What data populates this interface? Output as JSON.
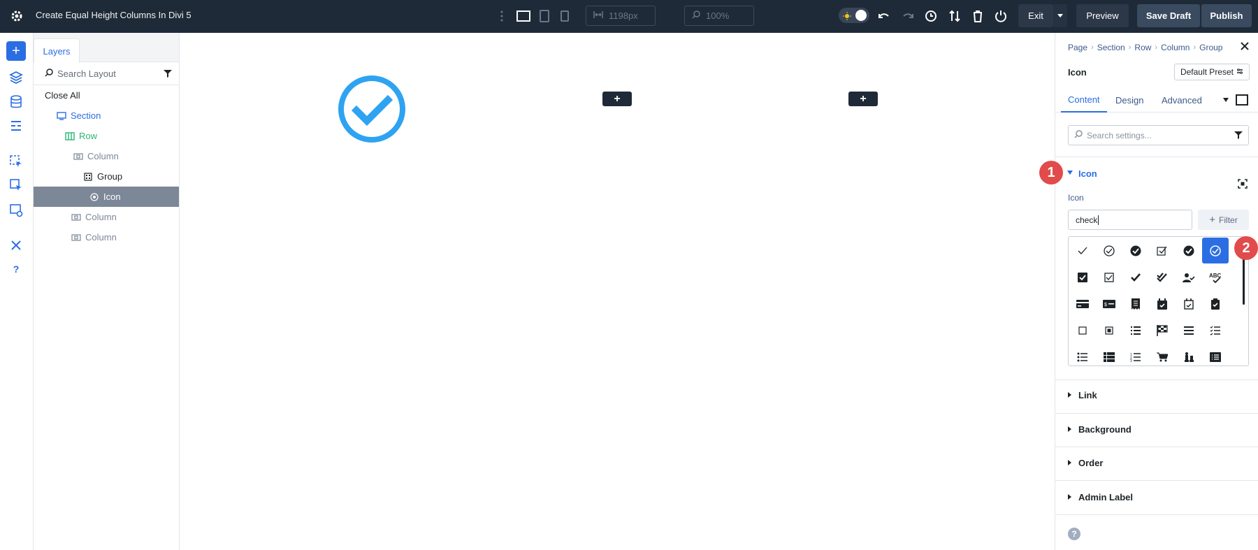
{
  "topbar": {
    "title": "Create Equal Height Columns In Divi 5",
    "width_field": "1198px",
    "zoom_field": "100%",
    "exit_label": "Exit",
    "preview_label": "Preview",
    "save_draft_label": "Save Draft",
    "publish_label": "Publish"
  },
  "layers": {
    "tab_label": "Layers",
    "search_placeholder": "Search Layout",
    "close_all": "Close All",
    "items": [
      {
        "label": "Section",
        "color": "#2b6ee4"
      },
      {
        "label": "Row",
        "color": "#2bb673"
      },
      {
        "label": "Column",
        "color": "#7c8797"
      },
      {
        "label": "Group",
        "color": "#1d2327"
      },
      {
        "label": "Icon",
        "color": "#ffffff"
      },
      {
        "label": "Column",
        "color": "#7c8797"
      },
      {
        "label": "Column",
        "color": "#7c8797"
      }
    ]
  },
  "settings": {
    "breadcrumbs": [
      "Page",
      "Section",
      "Row",
      "Column",
      "Group"
    ],
    "module_title": "Icon",
    "preset_label": "Default Preset",
    "tabs": [
      "Content",
      "Design",
      "Advanced"
    ],
    "search_placeholder": "Search settings...",
    "icon_group": "Icon",
    "icon_field_label": "Icon",
    "icon_search_value": "check",
    "filter_label": "Filter",
    "groups": [
      "Link",
      "Background",
      "Order",
      "Admin Label"
    ],
    "badges": [
      "1",
      "2"
    ]
  },
  "colors": {
    "accent": "#2b6ee4",
    "topbar": "#1f2a38",
    "check_icon": "#2ea3f2",
    "badge": "#e24b4b"
  }
}
